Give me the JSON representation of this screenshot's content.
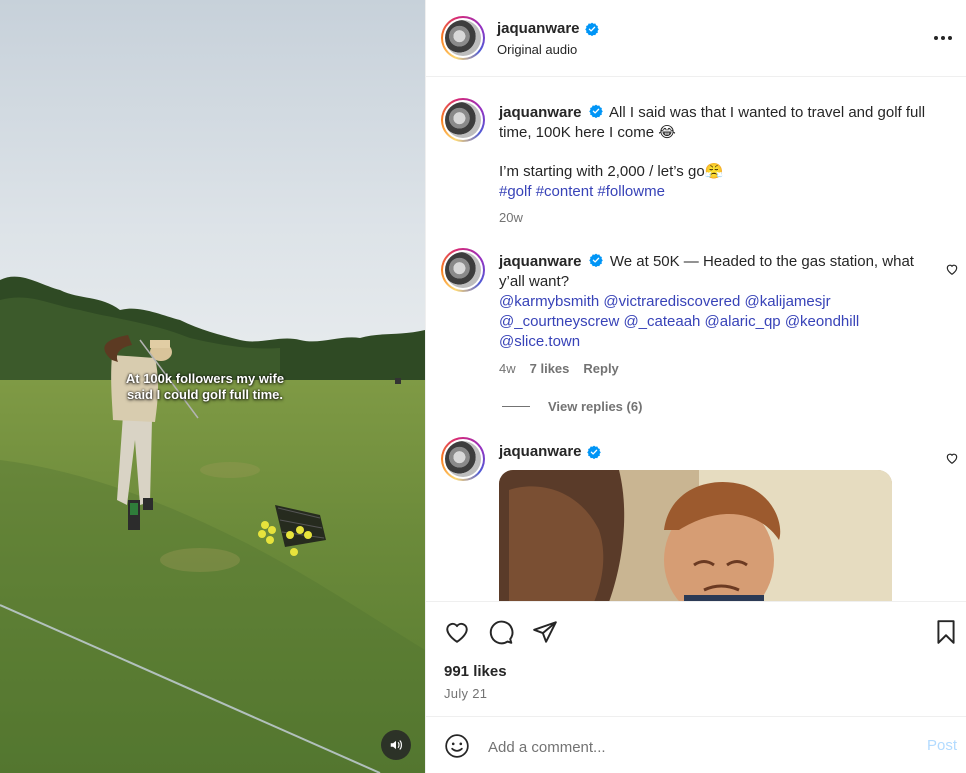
{
  "media": {
    "overlay_caption": "At 100k followers my wife\nsaid I could golf full time.",
    "sound_icon": "speaker-icon"
  },
  "header": {
    "username": "jaquanware",
    "subtitle": "Original audio",
    "more_icon": "more-horizontal-icon"
  },
  "caption": {
    "username": "jaquanware",
    "text_line1": "All I said was that I wanted to travel and golf full time, 100K here I come 😂",
    "text_line2": "I’m starting with 2,000 / let’s go😤",
    "hashtags": "#golf #content #followme",
    "time": "20w"
  },
  "comment1": {
    "username": "jaquanware",
    "text": "We at 50K — Headed to the gas station, what y’all want?",
    "mentions": "@karmybsmith @victrarediscovered @kalijamesjr @_courtneyscrew @_cateaah @alaric_qp @keondhill @slice.town",
    "time": "4w",
    "likes": "7 likes",
    "reply": "Reply",
    "view_replies": "View replies (6)"
  },
  "comment2": {
    "username": "jaquanware"
  },
  "footer": {
    "likes": "991 likes",
    "date": "July 21",
    "comment_placeholder": "Add a comment...",
    "post_label": "Post"
  },
  "colors": {
    "verified": "#0095f6",
    "link": "#3843b8",
    "post_disabled": "#b3dbff"
  }
}
